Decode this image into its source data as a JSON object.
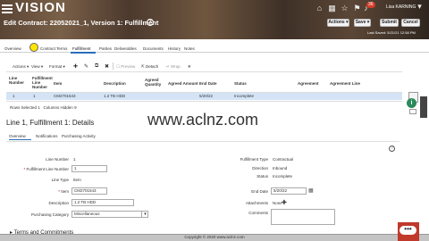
{
  "header": {
    "logo": "VISION",
    "page_title": "Edit Contract: 22052021_1, Version 1: Fulfillment",
    "notification_count": "36",
    "user_name": "Lisa KARNING",
    "actions_label": "Actions ▾",
    "save_label": "Save ▾",
    "submit_label": "Submit",
    "cancel_label": "Cancel",
    "last_saved": "Last Saved: 5/21/21 12:58 PM"
  },
  "tabs": [
    "Overview",
    "Contract Terms",
    "Fulfillment",
    "Parties",
    "Deliverables",
    "Documents",
    "History",
    "Notes"
  ],
  "toolbar": {
    "actions": "Actions ▾",
    "view": "View ▾",
    "format": "Format ▾",
    "preview": "Preview",
    "detach": "Detach",
    "wrap": "Wrap"
  },
  "table": {
    "headers": {
      "line_number": "Line Number",
      "fulfillment_line_number": "Fulfillment Line Number",
      "item": "Item",
      "description": "Description",
      "agreed_quantity": "Agreed Quantity",
      "agreed_amount": "Agreed Amount",
      "end_date": "End Date",
      "status": "Status",
      "agreement": "Agreement",
      "agreement_line": "Agreement Line"
    },
    "row": {
      "line_number": "1",
      "fulfillment_line_number": "1",
      "item": "CM2701543",
      "description": "1.2 TB HDD",
      "end_date": "5/20/22",
      "status": "Incomplete"
    },
    "rows_selected": "Rows Selected  1",
    "columns_hidden": "Columns Hidden  9"
  },
  "detail": {
    "title": "Line 1, Fulfillment 1: Details",
    "subtabs": [
      "Overview",
      "Notifications",
      "Purchasing Activity"
    ],
    "fields": {
      "line_number_label": "Line Number",
      "line_number_value": "1",
      "fulfillment_line_number_label": "Fulfillment Line Number",
      "fulfillment_line_number_value": "1",
      "line_type_label": "Line Type",
      "line_type_value": "Item",
      "item_label": "Item",
      "item_value": "CM2701543",
      "description_label": "Description",
      "description_value": "1.2 TB HDD",
      "purchasing_category_label": "Purchasing Category",
      "purchasing_category_value": "Miscellaneous",
      "fulfillment_type_label": "Fulfillment Type",
      "fulfillment_type_value": "Contractual",
      "direction_label": "Direction",
      "direction_value": "Inbound",
      "status_label": "Status",
      "status_value": "Incomplete",
      "end_date_label": "End Date",
      "end_date_value": "5/20/22",
      "attachments_label": "Attachments",
      "attachments_value": "None",
      "comments_label": "Comments"
    },
    "bottom_section": "▸ Terms and Commitments"
  },
  "watermark": "www.aclnz.com",
  "footer": {
    "copyright": "Copyright © 2020 www.aclnz.com",
    "dots": "•••"
  }
}
